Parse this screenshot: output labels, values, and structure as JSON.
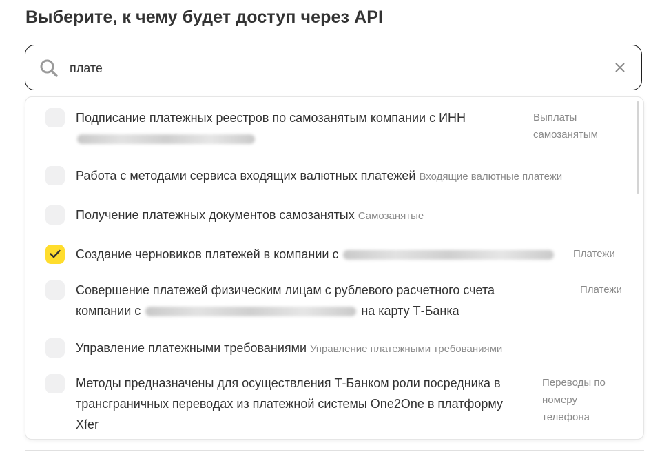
{
  "page": {
    "title": "Выберите, к чему будет доступ через API"
  },
  "search": {
    "value": "плате"
  },
  "items": [
    {
      "label": "Подписание платежных реестров по самозанятым компании с ИНН",
      "category_line1": "Выплаты",
      "category_line2": "самозанятым",
      "checked": false
    },
    {
      "label": "Работа с методами сервиса входящих валютных платежей",
      "category": "Входящие валютные платежи",
      "checked": false
    },
    {
      "label": "Получение платежных документов самозанятых",
      "category": "Самозанятые",
      "checked": false
    },
    {
      "label": "Создание черновиков платежей в компании с",
      "category": "Платежи",
      "checked": true
    },
    {
      "label_line1": "Совершение платежей физическим лицам с рублевого расчетного счета",
      "label_line2_prefix": "компании с",
      "label_line2_suffix": "на карту Т‑Банка",
      "category": "Платежи",
      "checked": false
    },
    {
      "label": "Управление платежными требованиями",
      "category": "Управление платежными требованиями",
      "checked": false
    },
    {
      "label_line1": "Методы предназначены для осуществления Т‑Банком роли посредника в",
      "label_line2": "трансграничных переводах из платежной системы One2One в платформу",
      "label_line3": "Xfer",
      "category_line1": "Переводы по",
      "category_line2": "номеру",
      "category_line3": "телефона",
      "checked": false
    }
  ],
  "colors": {
    "checkbox_checked": "#ffdd2d",
    "checkbox_unchecked": "#f0f0f1",
    "text": "#333333",
    "muted": "#8a8a8a"
  }
}
